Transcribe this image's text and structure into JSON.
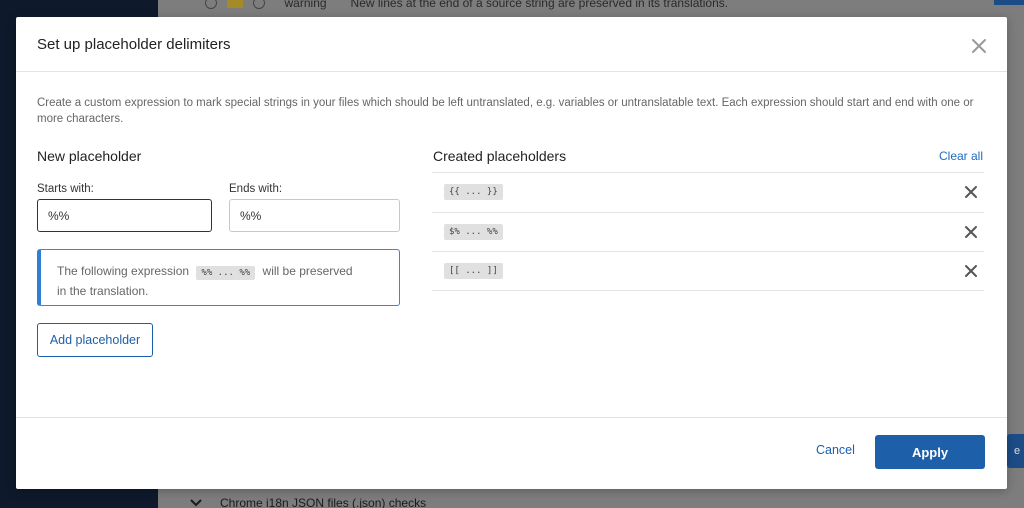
{
  "background": {
    "top_row_label": "warning",
    "top_row_text": "New lines at the end of a source string are preserved in its translations.",
    "bottom_row_text": "Chrome i18n JSON files (.json) checks",
    "right_edge_text": "e"
  },
  "modal": {
    "title": "Set up placeholder delimiters",
    "description": "Create a custom expression to mark special strings in your files which should be left untranslated, e.g. variables or untranslatable text. Each expression should start and end with one or more characters.",
    "new_placeholder": {
      "title": "New placeholder",
      "starts_label": "Starts with:",
      "starts_value": "%%",
      "ends_label": "Ends with:",
      "ends_value": "%%",
      "preview_before": "The following expression",
      "preview_code": "%% ... %%",
      "preview_after": "will be preserved",
      "preview_after2": "in the translation.",
      "add_label": "Add placeholder"
    },
    "created": {
      "title": "Created placeholders",
      "clear_all_label": "Clear all",
      "items": [
        {
          "expression": "{{ ... }}"
        },
        {
          "expression": "$% ... %%"
        },
        {
          "expression": "[[ ... ]]"
        }
      ]
    },
    "footer": {
      "cancel_label": "Cancel",
      "apply_label": "Apply"
    }
  },
  "colors": {
    "accent": "#1d5fa8",
    "link": "#1c6bc2",
    "preview_border": "#2f7fd3"
  },
  "icons": {
    "close": "close-icon",
    "remove": "close-icon"
  }
}
